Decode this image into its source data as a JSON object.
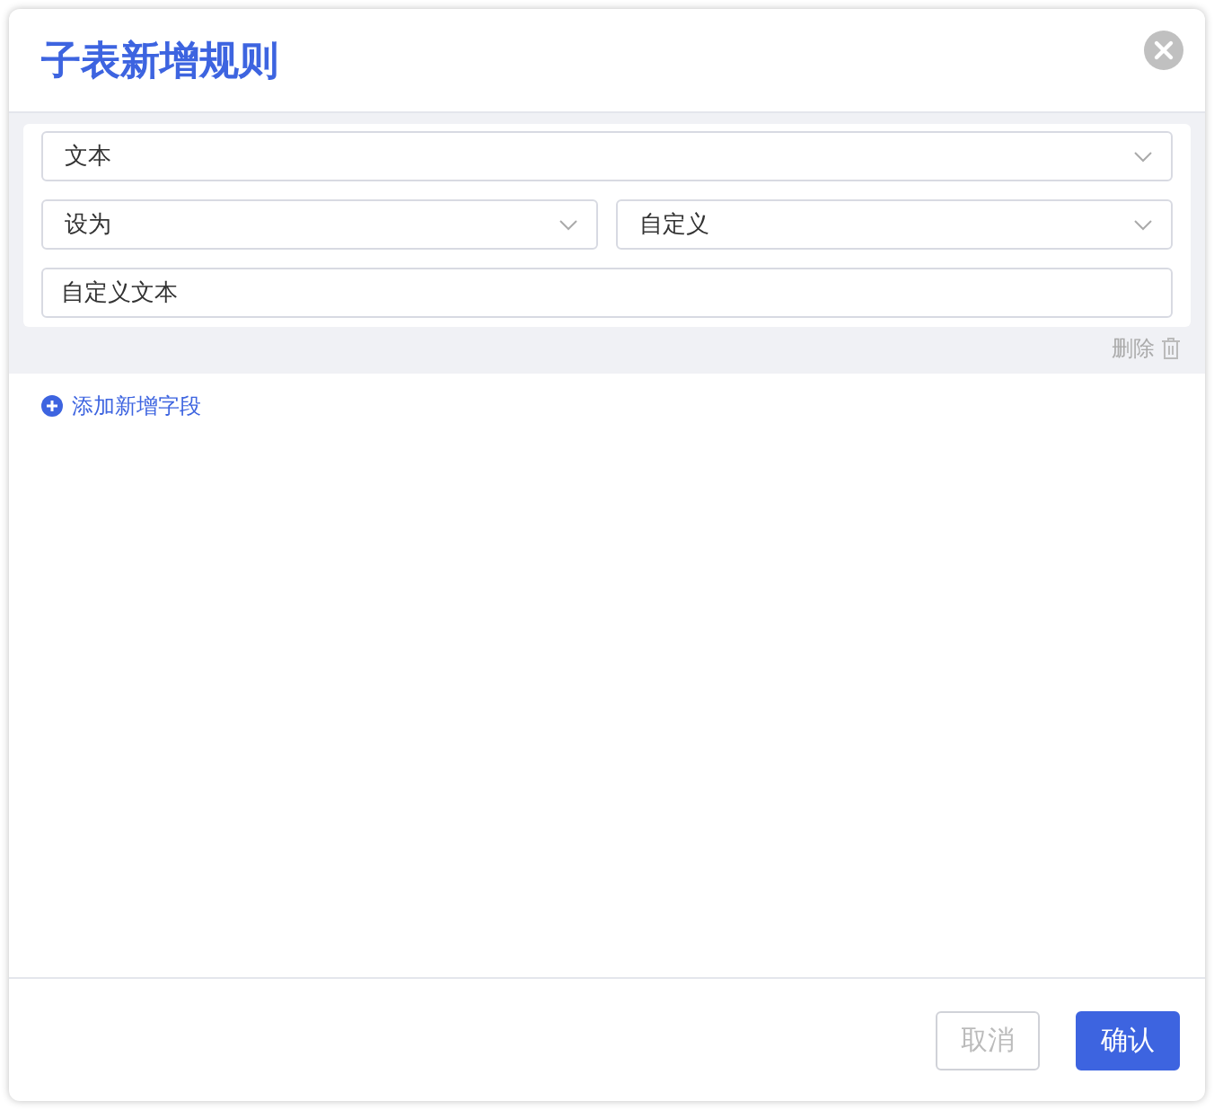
{
  "dialog": {
    "title": "子表新增规则"
  },
  "rule": {
    "field_select": {
      "value": "文本"
    },
    "action_select": {
      "value": "设为"
    },
    "source_select": {
      "value": "自定义"
    },
    "text_input": {
      "value": "自定义文本"
    },
    "delete_link": "删除"
  },
  "add_field_link": "添加新增字段",
  "buttons": [
    {
      "label": "取消",
      "kind": "secondary",
      "disabled": true
    },
    {
      "label": "确认",
      "kind": "primary",
      "disabled": false
    }
  ]
}
